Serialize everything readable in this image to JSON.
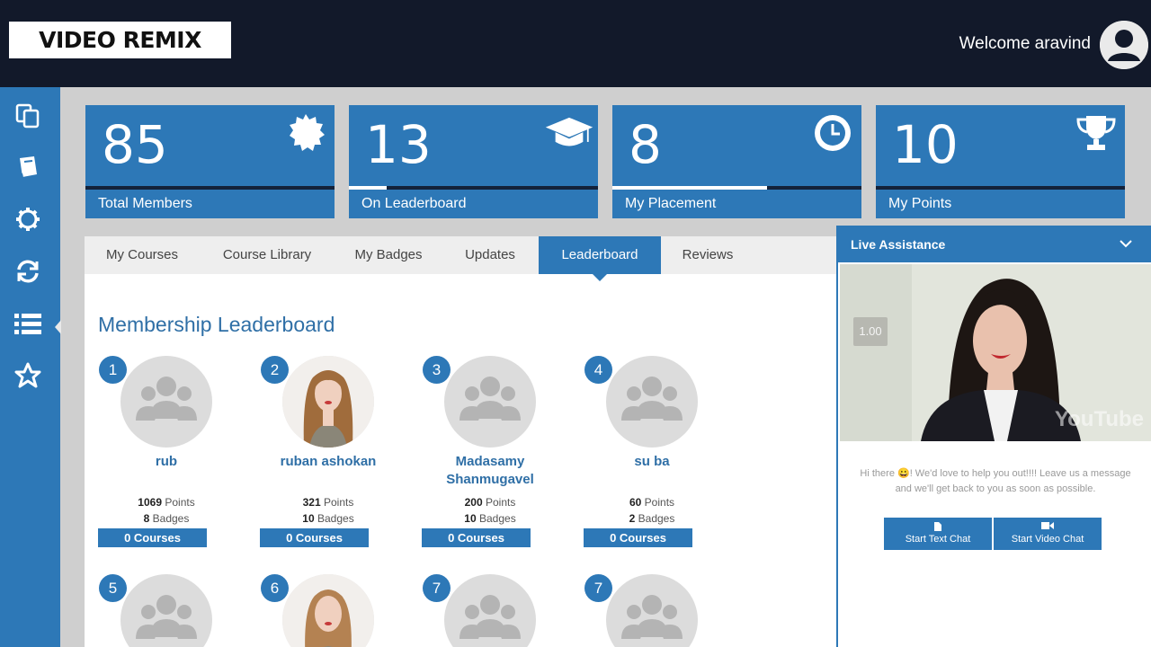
{
  "header": {
    "logo": "VIDEO REMIX",
    "welcome": "Welcome aravind"
  },
  "sidebar": {
    "items": [
      {
        "icon": "copy-icon"
      },
      {
        "icon": "book-icon"
      },
      {
        "icon": "gear-icon"
      },
      {
        "icon": "refresh-icon"
      },
      {
        "icon": "list-icon"
      },
      {
        "icon": "star-icon"
      }
    ]
  },
  "stats": [
    {
      "value": "85",
      "label": "Total Members",
      "icon": "badge-icon",
      "progress": 0
    },
    {
      "value": "13",
      "label": "On Leaderboard",
      "icon": "graduation-cap-icon",
      "progress": 0.15
    },
    {
      "value": "8",
      "label": "My Placement",
      "icon": "clock-icon",
      "progress": 0.62
    },
    {
      "value": "10",
      "label": "My Points",
      "icon": "trophy-icon",
      "progress": 0
    }
  ],
  "tabs": [
    {
      "label": "My Courses",
      "active": false
    },
    {
      "label": "Course Library",
      "active": false
    },
    {
      "label": "My Badges",
      "active": false
    },
    {
      "label": "Updates",
      "active": false
    },
    {
      "label": "Leaderboard",
      "active": true
    },
    {
      "label": "Reviews",
      "active": false
    }
  ],
  "leaderboard": {
    "title": "Membership Leaderboard",
    "members": [
      {
        "rank": "1",
        "name": "rub",
        "points": "1069",
        "points_label": "Points",
        "badges": "8",
        "badges_label": "Badges",
        "courses": "0 Courses",
        "photo": false
      },
      {
        "rank": "2",
        "name": "ruban ashokan",
        "points": "321",
        "points_label": "Points",
        "badges": "10",
        "badges_label": "Badges",
        "courses": "0 Courses",
        "photo": true
      },
      {
        "rank": "3",
        "name": "Madasamy Shanmugavel",
        "points": "200",
        "points_label": "Points",
        "badges": "10",
        "badges_label": "Badges",
        "courses": "0 Courses",
        "photo": false
      },
      {
        "rank": "4",
        "name": "su ba",
        "points": "60",
        "points_label": "Points",
        "badges": "2",
        "badges_label": "Badges",
        "courses": "0 Courses",
        "photo": false
      },
      {
        "rank": "5",
        "photo": false
      },
      {
        "rank": "6",
        "photo": true
      },
      {
        "rank": "7",
        "photo": false
      },
      {
        "rank": "7",
        "photo": false
      }
    ]
  },
  "live_assistance": {
    "title": "Live Assistance",
    "speed": "1.00",
    "watermark": "YouTube",
    "message": "Hi there 😀! We'd love to help you out!!!! Leave us a message and we'll get back to you as soon as possible.",
    "text_chat": "Start Text Chat",
    "video_chat": "Start Video Chat"
  },
  "colors": {
    "primary": "#2d78b7",
    "header": "#12192a",
    "name_text": "#2f6fa6"
  }
}
